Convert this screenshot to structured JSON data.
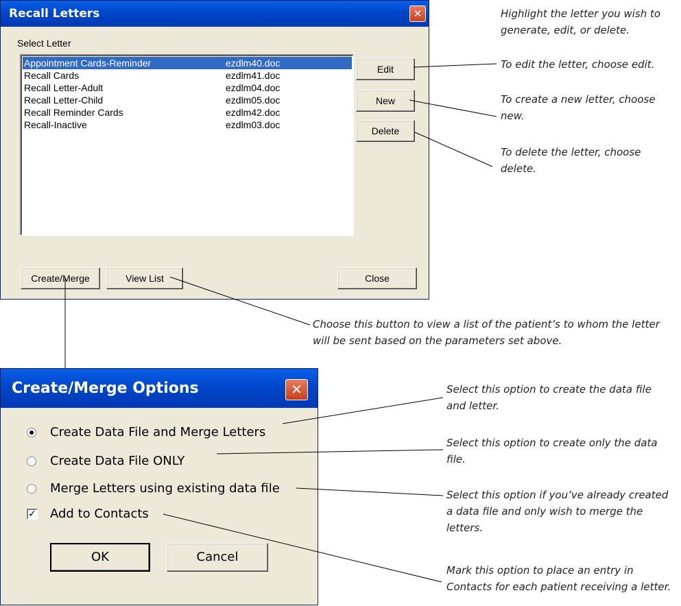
{
  "recall_dialog": {
    "title": "Recall Letters",
    "close_glyph": "✕",
    "list_label": "Select Letter",
    "letters": [
      {
        "name": "Appointment Cards-Reminder",
        "file": "ezdlm40.doc",
        "selected": true
      },
      {
        "name": "Recall Cards",
        "file": "ezdlm41.doc"
      },
      {
        "name": "Recall Letter-Adult",
        "file": "ezdlm04.doc"
      },
      {
        "name": "Recall Letter-Child",
        "file": "ezdlm05.doc"
      },
      {
        "name": "Recall Reminder Cards",
        "file": "ezdlm42.doc"
      },
      {
        "name": "Recall-Inactive",
        "file": "ezdlm03.doc"
      }
    ],
    "buttons": {
      "edit": "Edit",
      "new": "New",
      "delete": "Delete",
      "create_merge": "Create/Merge",
      "view_list": "View List",
      "close": "Close"
    }
  },
  "merge_dialog": {
    "title": "Create/Merge Options",
    "close_glyph": "✕",
    "options": [
      {
        "label": "Create Data File and Merge Letters",
        "checked": true
      },
      {
        "label": "Create Data File ONLY",
        "checked": false
      },
      {
        "label": "Merge Letters using existing data file",
        "checked": false
      }
    ],
    "add_contacts": {
      "label": "Add to Contacts",
      "checked": true,
      "check_glyph": "✓"
    },
    "buttons": {
      "ok": "OK",
      "cancel": "Cancel"
    }
  },
  "annotations": {
    "highlight": [
      "Highlight the letter you wish to",
      "generate, edit, or delete."
    ],
    "edit": [
      "To edit the letter, choose edit."
    ],
    "new": [
      "To create a new letter, choose",
      "new."
    ],
    "delete": [
      "To delete the letter, choose",
      "delete."
    ],
    "view_list": [
      "Choose this button to view a list of the patient’s to whom the letter",
      "will be sent based on the parameters set above."
    ],
    "opt1": [
      "Select this option to create the data file",
      "and letter."
    ],
    "opt2": [
      "Select this option to create only the data",
      "file."
    ],
    "opt3": [
      "Select this option if you’ve already created",
      "a data file and only wish to merge the",
      "letters."
    ],
    "contacts": [
      "Mark this option to place an entry in",
      "Contacts for each patient receiving a letter."
    ]
  }
}
